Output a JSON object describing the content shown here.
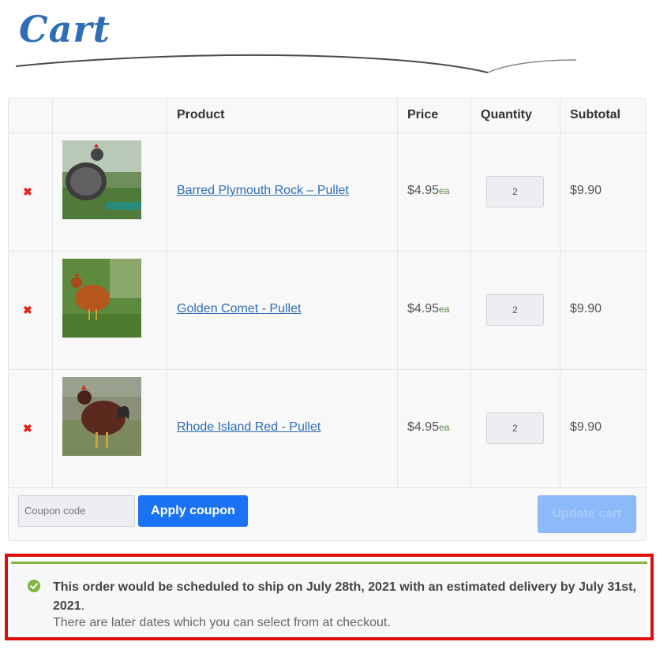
{
  "page": {
    "title": "Cart"
  },
  "table": {
    "headers": [
      "",
      "",
      "Product",
      "Price",
      "Quantity",
      "Subtotal"
    ],
    "rows": [
      {
        "product": "Barred Plymouth Rock – Pullet",
        "price": "$4.95",
        "unit": "ea",
        "quantity": "2",
        "subtotal": "$9.90"
      },
      {
        "product": "Golden Comet - Pullet",
        "price": "$4.95",
        "unit": "ea",
        "quantity": "2",
        "subtotal": "$9.90"
      },
      {
        "product": "Rhode Island Red - Pullet",
        "price": "$4.95",
        "unit": "ea",
        "quantity": "2",
        "subtotal": "$9.90"
      }
    ]
  },
  "actions": {
    "coupon_placeholder": "Coupon code",
    "apply_label": "Apply coupon",
    "update_label": "Update cart"
  },
  "notice": {
    "bold_text": "This order would be scheduled to ship on July 28th, 2021 with an estimated delivery by July 31st, 2021",
    "period": ".",
    "sub_text": "There are later dates which you can select from at checkout."
  },
  "colors": {
    "brand_blue": "#1a73f5",
    "link_blue": "#2f6db5",
    "success_green": "#82b541",
    "highlight_red": "#e10b0b"
  }
}
